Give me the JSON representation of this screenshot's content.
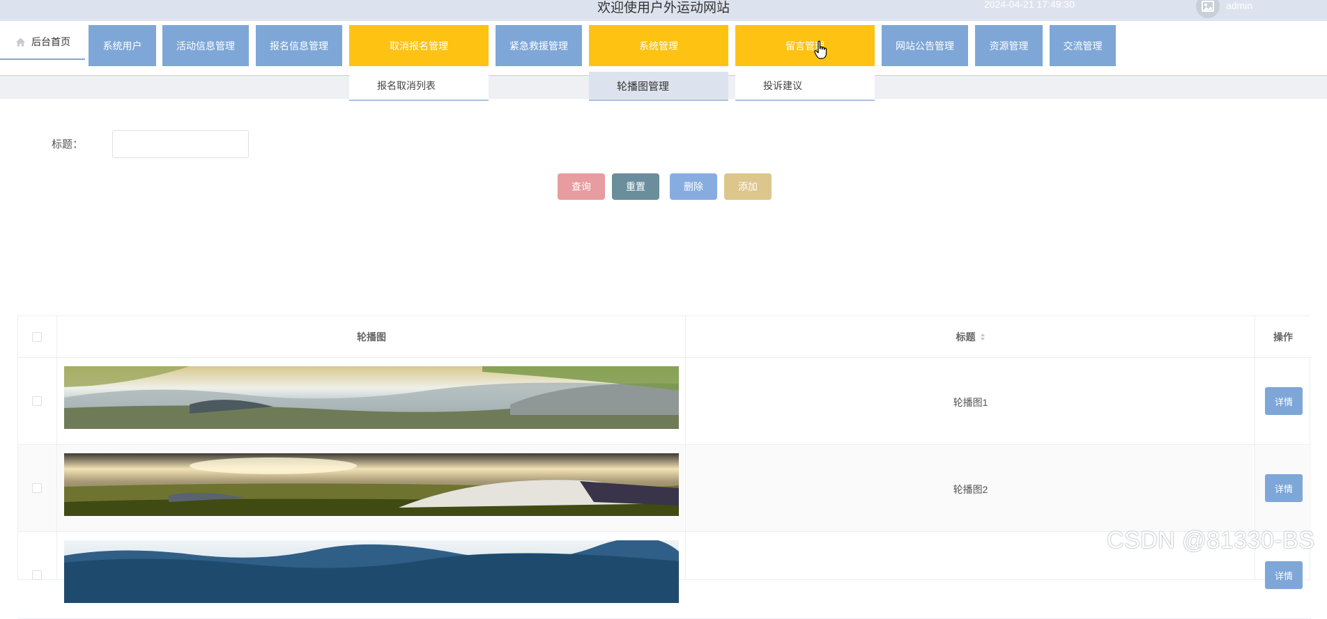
{
  "header": {
    "title": "欢迎使用户外运动网站",
    "datetime": "2024-04-21 17:49:30",
    "username": "admin"
  },
  "nav": {
    "home_label": "后台首页",
    "items": [
      {
        "label": "系统用户",
        "active": false
      },
      {
        "label": "活动信息管理",
        "active": false
      },
      {
        "label": "报名信息管理",
        "active": false
      },
      {
        "label": "取消报名管理",
        "active": true
      },
      {
        "label": "紧急救援管理",
        "active": false
      },
      {
        "label": "系统管理",
        "active": true
      },
      {
        "label": "留言管理",
        "active": true
      },
      {
        "label": "网站公告管理",
        "active": false
      },
      {
        "label": "资源管理",
        "active": false
      },
      {
        "label": "交流管理",
        "active": false
      }
    ],
    "dropdowns": [
      {
        "label": "报名取消列表"
      },
      {
        "label": "轮播图管理"
      },
      {
        "label": "投诉建议"
      }
    ]
  },
  "search": {
    "label": "标题：",
    "value": "",
    "placeholder": ""
  },
  "buttons": {
    "query": "查询",
    "reset": "重置",
    "delete": "删除",
    "add": "添加"
  },
  "colors": {
    "nav_blue": "#7ea7d8",
    "nav_active": "#fec213",
    "query_btn": "#e79c9f",
    "reset_btn": "#6a8e9b",
    "delete_btn": "#87ade0",
    "add_btn": "#dcc68c"
  },
  "table": {
    "columns": [
      "轮播图",
      "标题",
      "操作"
    ],
    "rows": [
      {
        "image": "landscape-mountains-image",
        "title": "轮播图1",
        "action": "详情"
      },
      {
        "image": "tent-meadow-image",
        "title": "轮播图2",
        "action": "详情"
      },
      {
        "image": "blue-mountains-image",
        "title": "",
        "action": "详情"
      }
    ]
  },
  "watermark": "CSDN @81330-BS"
}
